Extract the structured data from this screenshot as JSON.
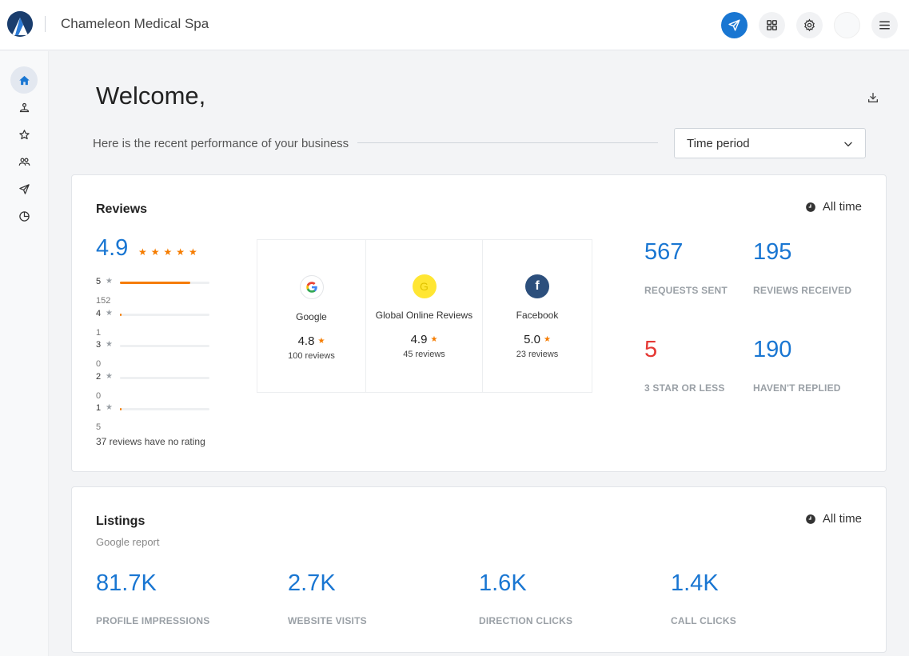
{
  "header": {
    "title": "Chameleon Medical Spa",
    "colors": {
      "primary": "#1976d2",
      "star": "#f57c00",
      "negative": "#e53935"
    },
    "icons": [
      "logo-icon",
      "send-icon",
      "apps-grid-icon",
      "gear-icon",
      "avatar-icon",
      "menu-icon"
    ]
  },
  "sidebar": {
    "items": [
      {
        "name": "home",
        "icon": "home-icon",
        "active": true
      },
      {
        "name": "listings",
        "icon": "map-pin-icon"
      },
      {
        "name": "reviews",
        "icon": "star-icon"
      },
      {
        "name": "contacts",
        "icon": "people-icon"
      },
      {
        "name": "send",
        "icon": "send-icon"
      },
      {
        "name": "reports",
        "icon": "pie-chart-icon"
      }
    ]
  },
  "main": {
    "welcome": "Welcome,",
    "subtitle": "Here is the recent performance of your business",
    "period_placeholder": "Time period"
  },
  "reviews": {
    "title": "Reviews",
    "range": "All time",
    "average": "4.9",
    "stars": "★★★★★",
    "distribution": [
      {
        "stars": "5",
        "count": "152",
        "fraction": 0.79
      },
      {
        "stars": "4",
        "count": "1",
        "fraction": 0.01
      },
      {
        "stars": "3",
        "count": "0",
        "fraction": 0
      },
      {
        "stars": "2",
        "count": "0",
        "fraction": 0
      },
      {
        "stars": "1",
        "count": "5",
        "fraction": 0.02
      }
    ],
    "no_rating": "37 reviews have no rating",
    "sources": [
      {
        "name": "Google",
        "logo": "G",
        "rating": "4.8",
        "count": "100 reviews"
      },
      {
        "name": "Global Online Reviews",
        "logo": "G",
        "rating": "4.9",
        "count": "45 reviews"
      },
      {
        "name": "Facebook",
        "logo": "f",
        "rating": "5.0",
        "count": "23 reviews"
      }
    ],
    "stats": [
      {
        "value": "567",
        "label": "REQUESTS SENT"
      },
      {
        "value": "195",
        "label": "REVIEWS RECEIVED"
      },
      {
        "value": "5",
        "label": "3 STAR OR LESS"
      },
      {
        "value": "190",
        "label": "HAVEN'T REPLIED"
      }
    ]
  },
  "listings": {
    "title": "Listings",
    "subtitle": "Google report",
    "range": "All time",
    "stats": [
      {
        "value": "81.7K",
        "label": "PROFILE IMPRESSIONS"
      },
      {
        "value": "2.7K",
        "label": "WEBSITE VISITS"
      },
      {
        "value": "1.6K",
        "label": "DIRECTION CLICKS"
      },
      {
        "value": "1.4K",
        "label": "CALL CLICKS"
      }
    ]
  }
}
